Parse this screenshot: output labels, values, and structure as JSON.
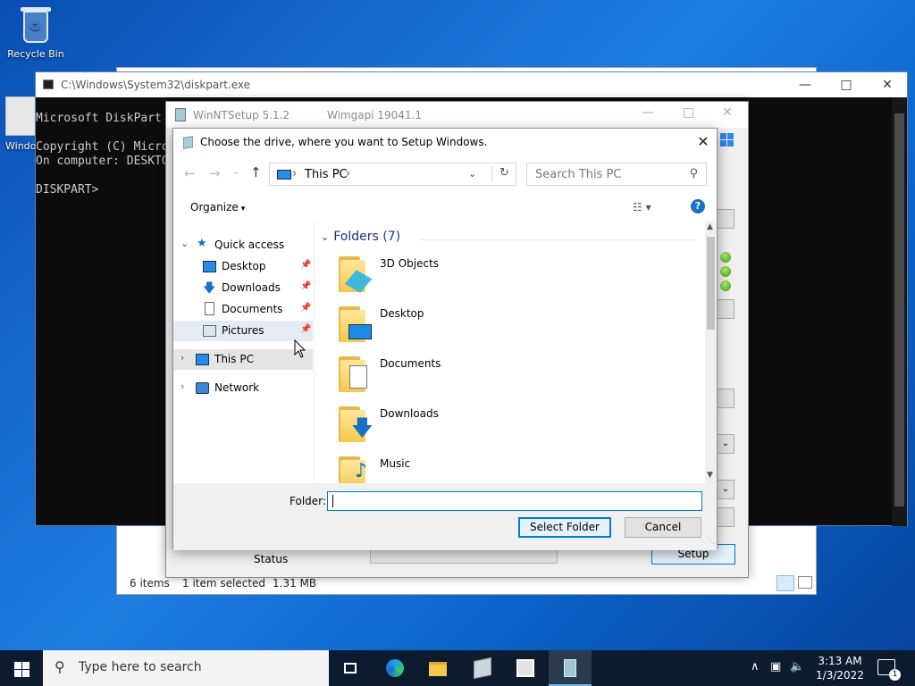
{
  "desktop": {
    "recycle_bin_label": "Recycle Bin",
    "second_icon_label": "Windo"
  },
  "explorer_behind": {
    "status_items": "6 items",
    "status_selected": "1 item selected",
    "status_size": "1.31 MB"
  },
  "console": {
    "title": "C:\\Windows\\System32\\diskpart.exe",
    "lines": "Microsoft DiskPart\n\nCopyright (C) Micro\nOn computer: DESKTO\n\nDISKPART>",
    "controls": {
      "minimize": "—",
      "maximize": "□",
      "close": "✕"
    }
  },
  "winntsetup": {
    "title": "WinNTSetup 5.1.2",
    "wimgapi": "Wimgapi 19041.1",
    "status_label": "Status",
    "setup_button": "Setup"
  },
  "dialog": {
    "title": "Choose the drive, where you want to Setup Windows.",
    "close": "✕",
    "address": {
      "location": "This PC",
      "sep1": "›",
      "sep2": "›",
      "dropdown": "⌄",
      "refresh": "↻"
    },
    "search": {
      "placeholder": "Search This PC",
      "icon": "search-icon"
    },
    "nav_arrows": {
      "back": "←",
      "forward": "→",
      "recent": "⌄",
      "up": "↑"
    },
    "toolbar": {
      "organize": "Organize",
      "organize_caret": "▾",
      "view_icon": "☷ ▾",
      "help": "?"
    },
    "nav_pane": [
      {
        "label": "Quick access",
        "chevron": "⌄",
        "icon": "star-icon"
      },
      {
        "label": "Desktop",
        "pin": "📌",
        "icon": "desktop-icon"
      },
      {
        "label": "Downloads",
        "pin": "📌",
        "icon": "downloads-icon"
      },
      {
        "label": "Documents",
        "pin": "📌",
        "icon": "documents-icon"
      },
      {
        "label": "Pictures",
        "pin": "📌",
        "icon": "pictures-icon"
      },
      {
        "label": "This PC",
        "chevron": "›",
        "icon": "this-pc-icon"
      },
      {
        "label": "Network",
        "chevron": "›",
        "icon": "network-icon"
      }
    ],
    "group_header": "Folders (7)",
    "group_chevron": "⌄",
    "folders": [
      {
        "label": "3D Objects",
        "icon": "3d-objects-icon"
      },
      {
        "label": "Desktop",
        "icon": "desktop-folder-icon"
      },
      {
        "label": "Documents",
        "icon": "documents-folder-icon"
      },
      {
        "label": "Downloads",
        "icon": "downloads-folder-icon"
      },
      {
        "label": "Music",
        "icon": "music-folder-icon"
      }
    ],
    "folder_label": "Folder:",
    "folder_value": "",
    "select_button": "Select Folder",
    "cancel_button": "Cancel"
  },
  "taskbar": {
    "search_placeholder": "Type here to search",
    "apps": [
      "task-view-icon",
      "edge-icon",
      "file-explorer-icon",
      "setup-app-icon",
      "window-app-icon",
      "winntsetup-icon"
    ],
    "tray": {
      "chevron": "∧",
      "time": "3:13 AM",
      "date": "1/3/2022",
      "notification_count": "1"
    }
  },
  "colors": {
    "accent": "#0078d7",
    "desktop": "#1a6fd1",
    "taskbar": "#0d1b2e",
    "console_bg": "#0c0c0c"
  }
}
